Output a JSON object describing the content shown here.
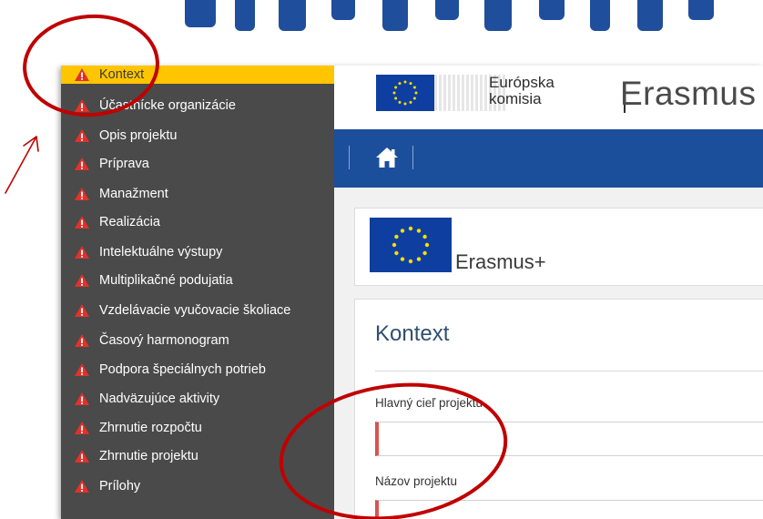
{
  "sidebar": {
    "items": [
      {
        "label": "Kontext"
      },
      {
        "label": "Účastnícke organizácie"
      },
      {
        "label": "Opis projektu"
      },
      {
        "label": "Príprava"
      },
      {
        "label": "Manažment"
      },
      {
        "label": "Realizácia"
      },
      {
        "label": "Intelektuálne výstupy"
      },
      {
        "label": "Multiplikačné podujatia"
      },
      {
        "label": "Vzdelávacie vyučovacie školiace"
      },
      {
        "label": "Časový harmonogram"
      },
      {
        "label": "Podpora špeciálnych potrieb"
      },
      {
        "label": "Nadväzujúce aktivity"
      },
      {
        "label": "Zhrnutie rozpočtu"
      },
      {
        "label": "Zhrnutie projektu"
      },
      {
        "label": "Prílohy"
      }
    ],
    "active_index": 0,
    "warning_icon": "warning-triangle-icon",
    "colors": {
      "background": "#4a4a4a",
      "active": "#ffc600",
      "warning": "#e2312b"
    }
  },
  "header": {
    "ec_logo_line1": "Európska",
    "ec_logo_line2": "komisia",
    "app_title": "Erasmus"
  },
  "navbar": {
    "home_icon": "home-icon",
    "color": "#1b4f9c"
  },
  "brand": {
    "name": "Erasmus+"
  },
  "form": {
    "section_title": "Kontext",
    "fields": [
      {
        "label": "Hlavný cieľ projektu",
        "value": ""
      },
      {
        "label": "Názov projektu",
        "value": ""
      }
    ],
    "required_color": "#d9534f"
  },
  "annotations": {
    "color": "#c00000"
  }
}
